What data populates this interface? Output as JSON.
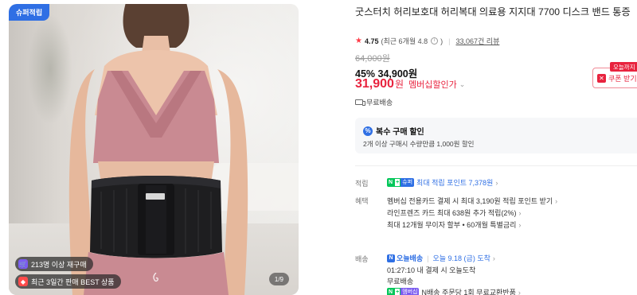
{
  "gallery": {
    "badge": "슈퍼적립",
    "chip_repurchase": "213명 이상 재구매",
    "chip_best": "최근 3일간 판매 BEST 상품",
    "pager": "1/9"
  },
  "product": {
    "title": "굿스터치 허리보호대 허리복대 의료용 지지대 7700 디스크 밴드 통증",
    "rating_score": "4.75",
    "rating_detail": "(최근 6개월 4.8",
    "rating_detail_end": ")",
    "rating_info": "i",
    "reviews": "33,067건 리뷰",
    "original_price": "64,000원",
    "discount_rate": "45%",
    "sale_price": "34,900원",
    "member_price": "31,900",
    "member_unit": "원",
    "member_label": "멤버십할인가",
    "today_tag": "오늘까지",
    "coupon_label": "쿠폰 받기",
    "free_shipping": "무료배송"
  },
  "multi_buy": {
    "title": "복수 구매 할인",
    "desc": "2개 이상 구매시 수량만큼 1,000원 할인"
  },
  "points": {
    "label": "적립",
    "badge_n": "N",
    "badge_plus": "+",
    "badge_super": "슈퍼",
    "text": "최대 적립 포인트 7,378원"
  },
  "benefits": {
    "label": "혜택",
    "line1": "멤버십 전용카드 결제 시 최대 3,190원 적립 포인트 받기",
    "line2": "라인프렌즈 카드 최대 638원 추가 적립(2%)",
    "line3": "최대 12개월 무이자 할부 • 60개월 특별금리"
  },
  "delivery": {
    "label": "배송",
    "today_label": "오늘배송",
    "arrival": "오늘 9.18 (금) 도착",
    "cutoff": "01:27:10  내 결제 시 오늘도착",
    "shipping_fee": "무료배송",
    "badge_member": "멤버십",
    "exchange": "N배송 주문당 1회 무료교환반품"
  },
  "colors": {
    "accent_red": "#e8233e",
    "accent_blue": "#2f6fe4",
    "naver_green": "#03c75a"
  }
}
